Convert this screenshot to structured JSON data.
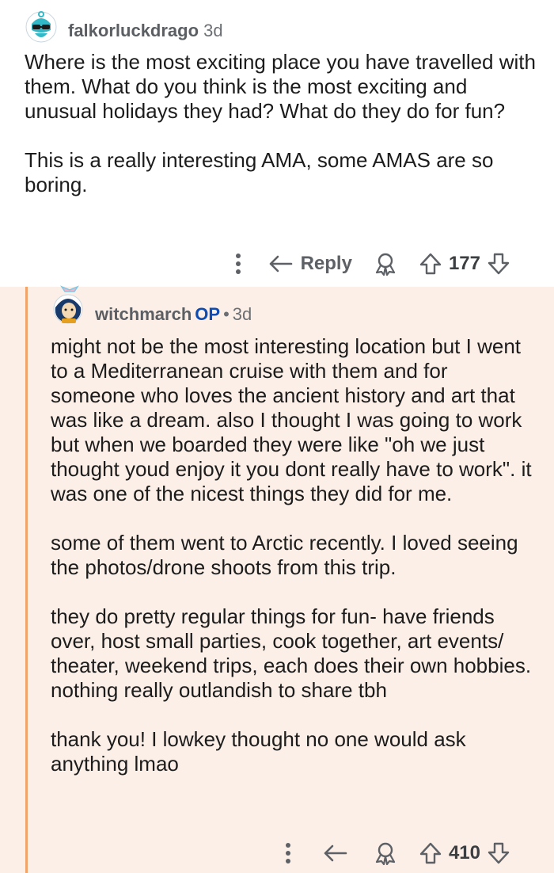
{
  "parent_comment": {
    "username": "falkorluckdrago",
    "age": "3d",
    "paragraphs": [
      "Where is the most exciting place you have travelled with them. What do you think is the most exciting and unusual holidays they had? What do they do for fun?",
      "This is a really interesting AMA, some AMAS are so boring."
    ],
    "actions": {
      "more_icon": "vertical-dots-icon",
      "reply_label": "Reply",
      "award_icon": "award-icon",
      "score": "177"
    }
  },
  "reply_comment": {
    "username": "witchmarch",
    "op_tag": "OP",
    "separator": "•",
    "age": "3d",
    "paragraphs": [
      "might not be the most interesting location but I went to a Mediterranean cruise with them and for someone who loves the ancient history and art that was like a dream. also I thought I was going to work but when we boarded they were like \"oh we just thought youd enjoy it you dont really have to work\". it was one of the nicest things they did for me.",
      "some of them went to Arctic recently. I loved seeing the photos/drone shoots from this trip.",
      "they do pretty regular things for fun- have friends over, host small parties, cook together, art events/ theater, weekend trips, each does their own hobbies. nothing really outlandish to share tbh",
      "thank you! I lowkey thought no one would ask anything lmao"
    ],
    "actions": {
      "more_icon": "vertical-dots-icon",
      "reply_icon": "reply-arrow-icon",
      "award_icon": "award-icon",
      "score": "410"
    }
  },
  "colors": {
    "reply_background": "#fcefe7",
    "thread_line": "#f1a46a",
    "op_tag": "#0e4cb3",
    "action_gray": "#5d6166"
  }
}
